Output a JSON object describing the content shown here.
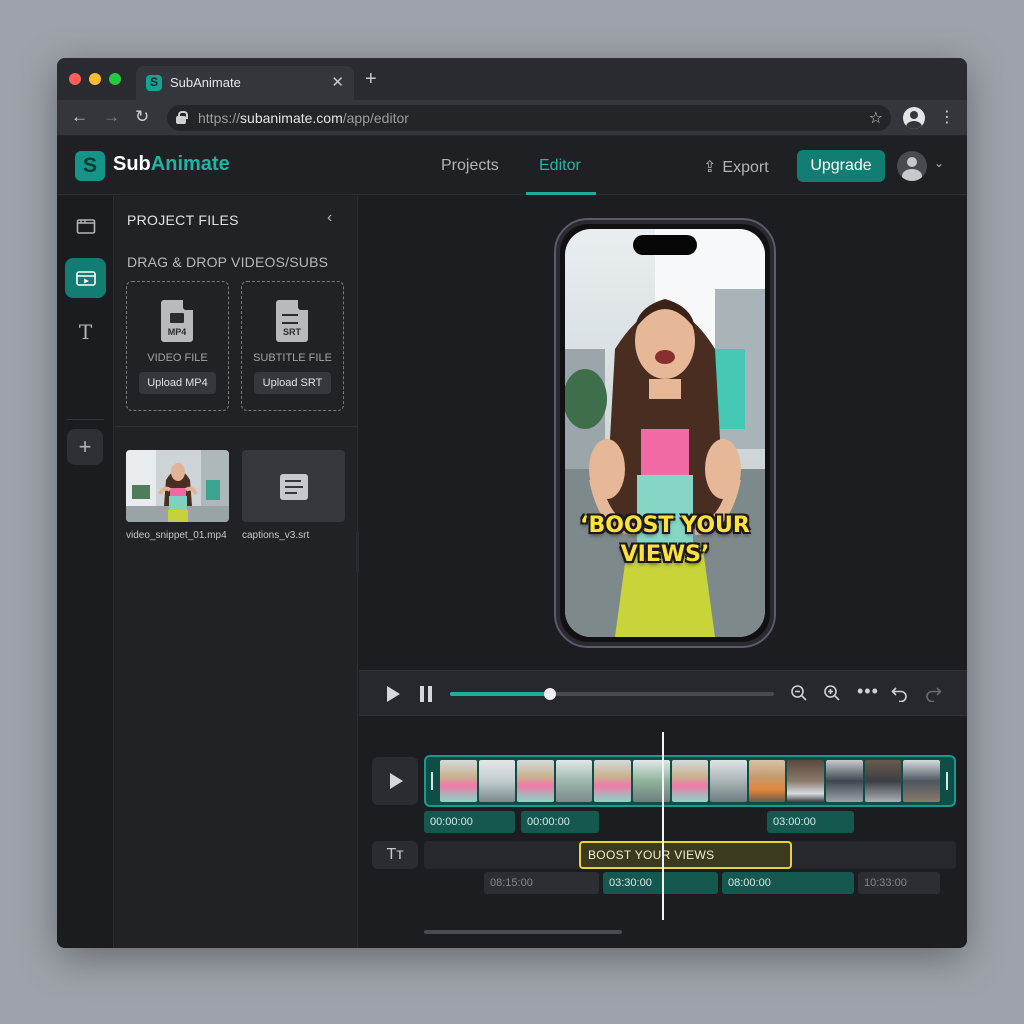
{
  "browser": {
    "tab_title": "SubAnimate",
    "url_prefix": "https://",
    "url_host": "subanimate.com",
    "url_path": "/app/editor",
    "traffic_lights": [
      "#fe5f57",
      "#febc2e",
      "#28c840"
    ]
  },
  "header": {
    "logo_part1": "Sub",
    "logo_part2": "Animate",
    "nav": [
      {
        "label": "Projects"
      },
      {
        "label": "Editor"
      }
    ],
    "active_nav": "Editor",
    "export_label": "Export",
    "upgrade_label": "Upgrade",
    "accent_color": "#1fb5a3"
  },
  "sidebar_rail": {
    "icons": [
      "folder-icon",
      "video-clip-icon",
      "text-icon",
      "add-icon"
    ],
    "active": "video-clip-icon"
  },
  "files_panel": {
    "title": "PROJECT FILES",
    "dropzone_label": "DRAG & DROP VIDEOS/SUBS",
    "video_dropzone": {
      "badge": "MP4",
      "type_label": "VIDEO FILE",
      "button": "Upload MP4"
    },
    "subtitle_dropzone": {
      "badge": "SRT",
      "type_label": "SUBTITLE FILE",
      "button": "Upload SRT"
    },
    "files": [
      {
        "name": "video_snippet_01.mp4",
        "icon": "video-thumbnail"
      },
      {
        "name": "captions_v3.srt",
        "icon": "document-icon"
      }
    ]
  },
  "preview": {
    "caption_line1": "‘BOOST YOUR",
    "caption_line2": "VIEWS’",
    "caption_color": "#ffe13d"
  },
  "playback": {
    "progress": 0.31,
    "icons": [
      "play-icon",
      "pause-icon",
      "zoom-out-icon",
      "zoom-in-icon",
      "more-icon",
      "undo-icon",
      "redo-icon"
    ]
  },
  "timeline": {
    "video_timecodes": [
      "00:00:00",
      "00:00:00",
      "03:00:00"
    ],
    "subtitle_clip": "BOOST YOUR VIEWS",
    "subtitle_timecodes": [
      "08:15:00",
      "03:30:00",
      "08:00:00",
      "10:33:00"
    ],
    "text_track_label": "Tт"
  }
}
